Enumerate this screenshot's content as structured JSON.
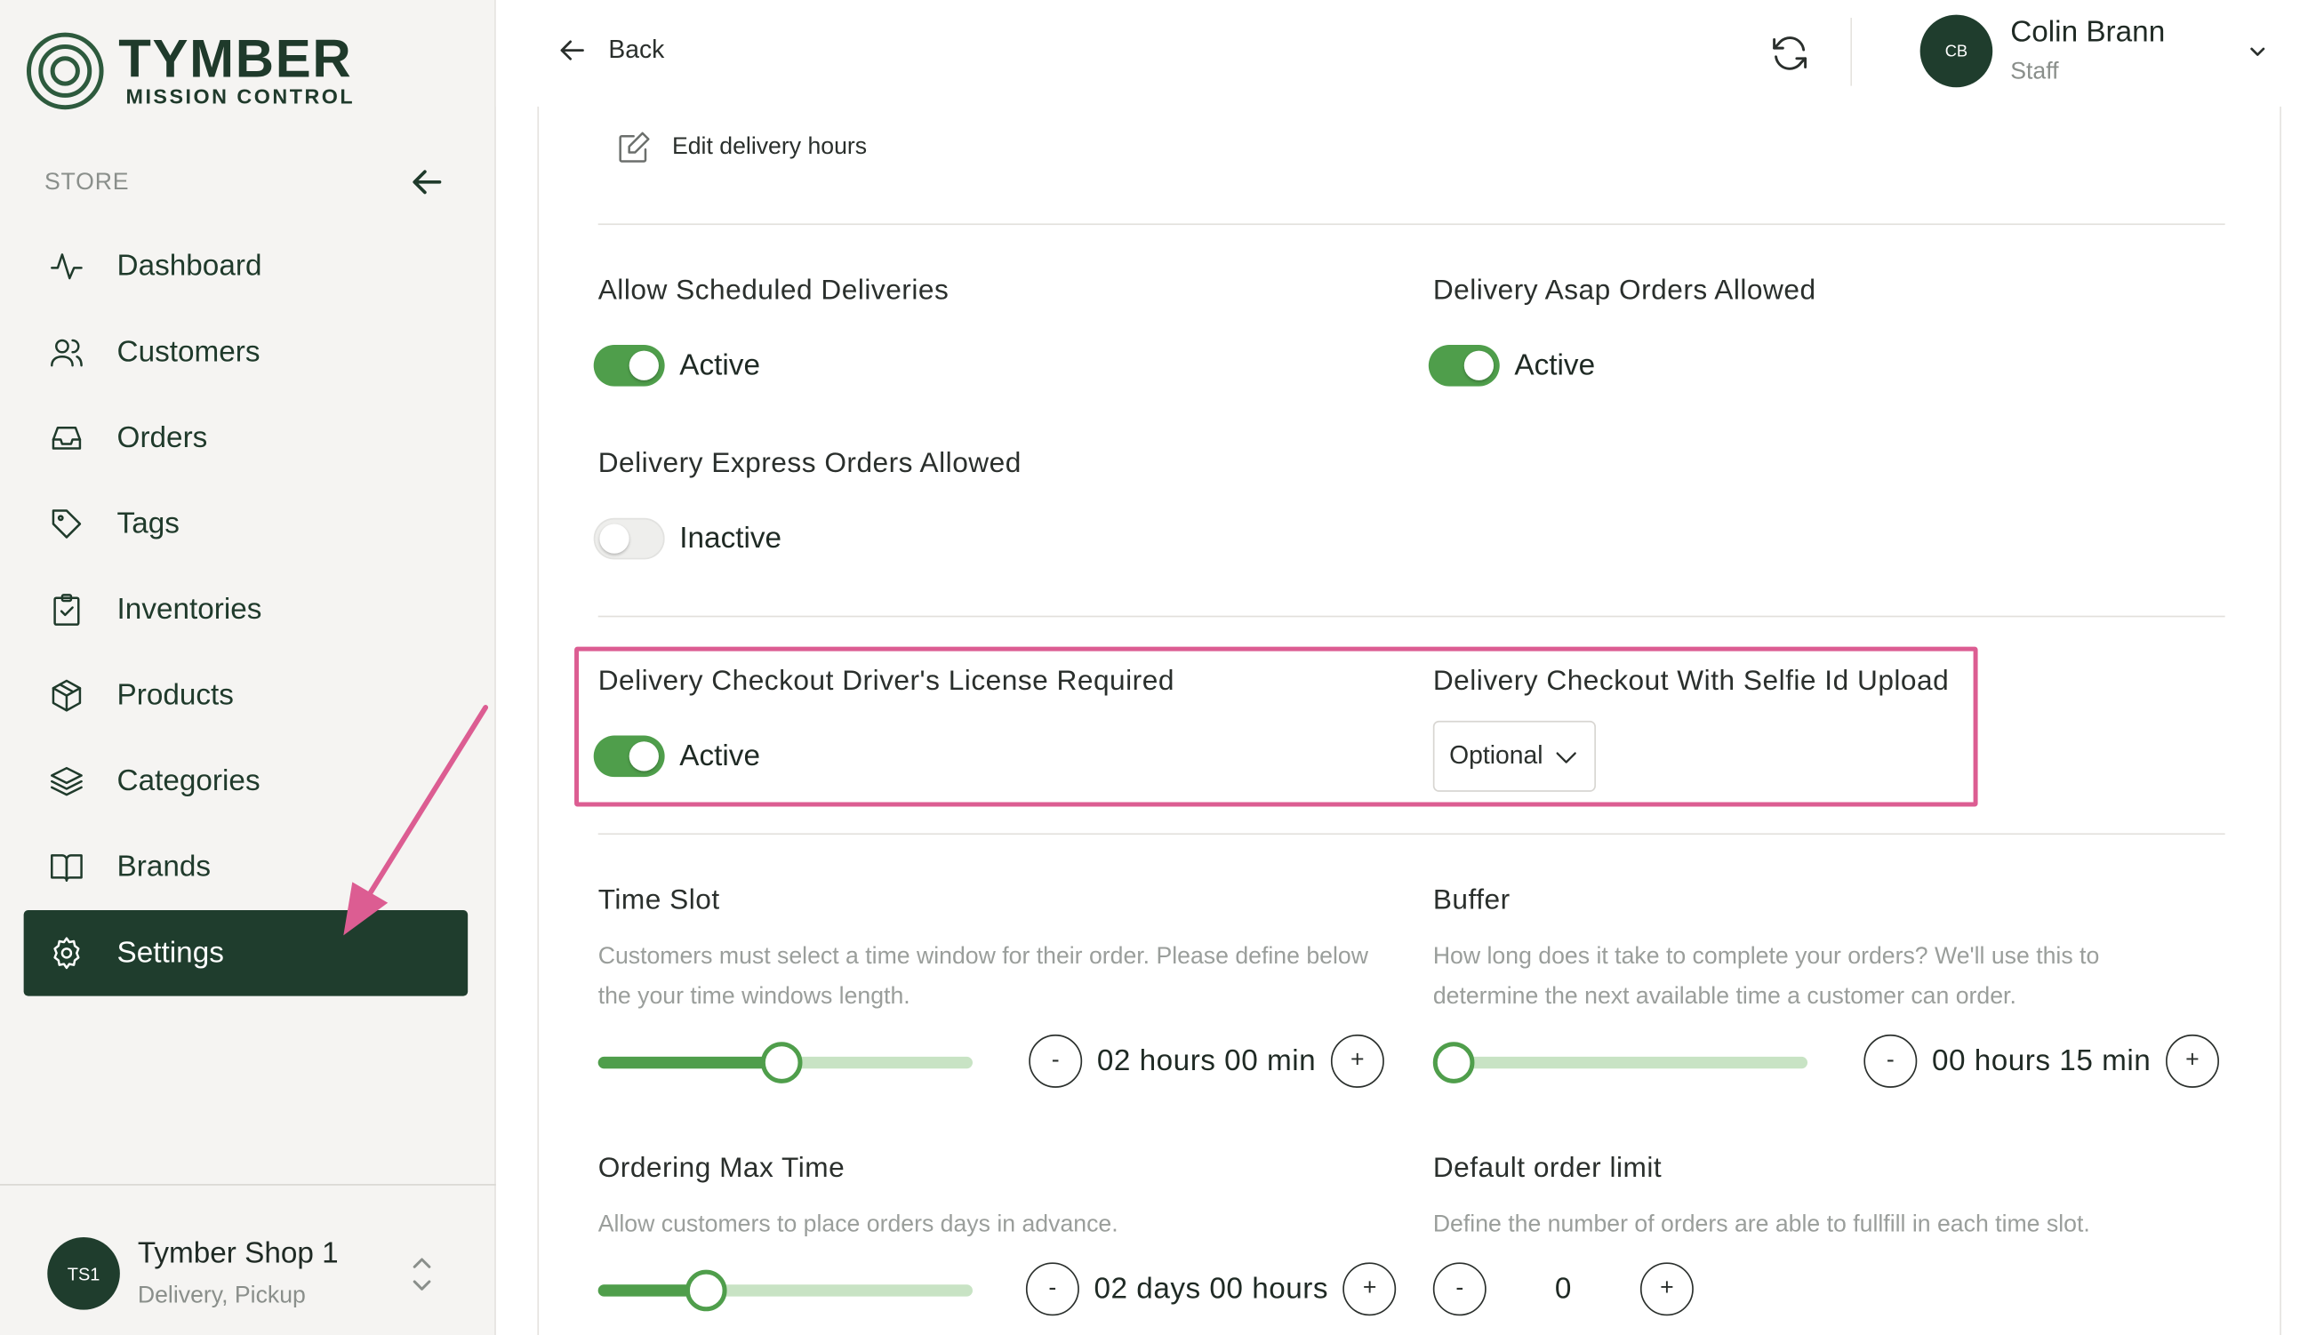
{
  "brand": {
    "title": "TYMBER",
    "subtitle": "MISSION CONTROL"
  },
  "sidebar": {
    "section_label": "STORE",
    "items": [
      {
        "label": "Dashboard",
        "icon": "activity-icon"
      },
      {
        "label": "Customers",
        "icon": "users-icon"
      },
      {
        "label": "Orders",
        "icon": "inbox-icon"
      },
      {
        "label": "Tags",
        "icon": "tag-icon"
      },
      {
        "label": "Inventories",
        "icon": "clipboard-check-icon"
      },
      {
        "label": "Products",
        "icon": "box-icon"
      },
      {
        "label": "Categories",
        "icon": "layers-icon"
      },
      {
        "label": "Brands",
        "icon": "book-open-icon"
      },
      {
        "label": "Settings",
        "icon": "gear-icon",
        "active": true
      }
    ],
    "shop": {
      "initials": "TS1",
      "name": "Tymber Shop 1",
      "modes": "Delivery, Pickup"
    }
  },
  "topbar": {
    "back_label": "Back",
    "user": {
      "initials": "CB",
      "name": "Colin Brann",
      "role": "Staff"
    }
  },
  "content": {
    "edit_hours_label": "Edit delivery hours",
    "allow_scheduled": {
      "label": "Allow Scheduled Deliveries",
      "state": "Active",
      "on": true
    },
    "asap_allowed": {
      "label": "Delivery Asap Orders Allowed",
      "state": "Active",
      "on": true
    },
    "express_allowed": {
      "label": "Delivery Express Orders Allowed",
      "state": "Inactive",
      "on": false
    },
    "license_required": {
      "label": "Delivery Checkout Driver's License Required",
      "state": "Active",
      "on": true
    },
    "selfie_upload": {
      "label": "Delivery Checkout With Selfie Id Upload",
      "value": "Optional"
    },
    "time_slot": {
      "label": "Time Slot",
      "description": "Customers must select a time window for their order. Please define below the your time windows length.",
      "value": "02 hours 00 min",
      "slider_fraction": 0.49
    },
    "buffer": {
      "label": "Buffer",
      "description": "How long does it take to complete your orders? We'll use this to determine the next available time a customer can order.",
      "value": "00 hours 15 min",
      "slider_fraction": 0.0
    },
    "ordering_max_time": {
      "label": "Ordering Max Time",
      "description": "Allow customers to place orders days in advance.",
      "value": "02 days 00 hours",
      "slider_fraction": 0.29
    },
    "default_order_limit": {
      "label": "Default order limit",
      "description": "Define the number of orders are able to fullfill in each time slot.",
      "value": "0"
    },
    "stepper_minus": "-",
    "stepper_plus": "+"
  },
  "colors": {
    "accent": "#4f9e4b",
    "sidebar_active": "#1f3d2d",
    "annotation": "#dc5d92"
  }
}
